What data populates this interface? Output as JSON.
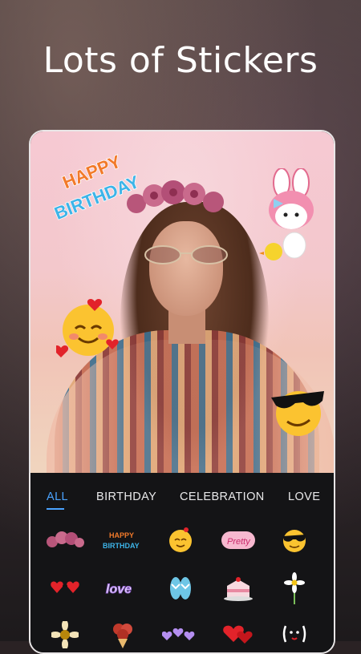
{
  "headline": "Lots of Stickers",
  "sticker_texts": {
    "happy": "HAPPY",
    "birthday": "BIRTHDAY"
  },
  "tabs": [
    {
      "label": "ALL",
      "active": true
    },
    {
      "label": "BIRTHDAY",
      "active": false
    },
    {
      "label": "CELEBRATION",
      "active": false
    },
    {
      "label": "LOVE",
      "active": false
    }
  ],
  "grid_stickers": [
    {
      "name": "flower-crown-sticker"
    },
    {
      "name": "happy-birthday-sticker",
      "text_line1": "HAPPY",
      "text_line2": "BIRTHDAY"
    },
    {
      "name": "blushing-emoji-sticker"
    },
    {
      "name": "pretty-text-sticker",
      "text": "Pretty"
    },
    {
      "name": "sunglasses-emoji-sticker"
    },
    {
      "name": "heart-glasses-sticker"
    },
    {
      "name": "love-text-sticker",
      "text": "love"
    },
    {
      "name": "sandals-sticker"
    },
    {
      "name": "cake-slice-sticker"
    },
    {
      "name": "daisy-sticker"
    },
    {
      "name": "sunflower-sticker"
    },
    {
      "name": "rose-bouquet-sticker"
    },
    {
      "name": "purple-hearts-sticker"
    },
    {
      "name": "red-hearts-sticker"
    },
    {
      "name": "cute-face-sticker"
    }
  ],
  "colors": {
    "accent": "#4aa3ff",
    "panel_bg": "#141416",
    "tab_text": "#e9e9ea"
  }
}
